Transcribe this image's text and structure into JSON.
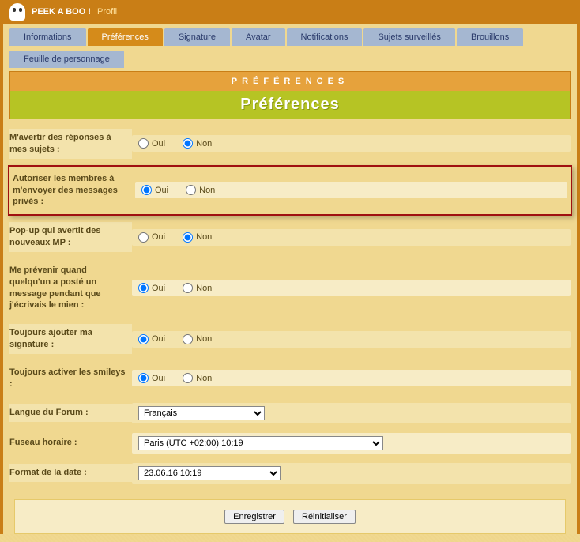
{
  "header": {
    "site_title": "PEEK A BOO !",
    "section": "Profil"
  },
  "tabs": {
    "informations": "Informations",
    "preferences": "Préférences",
    "signature": "Signature",
    "avatar": "Avatar",
    "notifications": "Notifications",
    "sujets": "Sujets surveillés",
    "brouillons": "Brouillons",
    "feuille": "Feuille de personnage"
  },
  "banner": {
    "crumb": "PRÉFÉRENCES",
    "stylized": "Préférences"
  },
  "labels": {
    "oui": "Oui",
    "non": "Non"
  },
  "rows": {
    "notify_responses": {
      "label": "M'avertir des réponses à mes sujets :",
      "value": "Non"
    },
    "allow_pm": {
      "label": "Autoriser les membres à m'envoyer des messages privés :",
      "value": "Oui"
    },
    "popup_pm": {
      "label": "Pop-up qui avertit des nouveaux MP :",
      "value": "Non"
    },
    "notify_concurrent": {
      "label": "Me prévenir quand quelqu'un a posté un message pendant que j'écrivais le mien :",
      "value": "Oui"
    },
    "add_signature": {
      "label": "Toujours ajouter ma signature :",
      "value": "Oui"
    },
    "enable_smileys": {
      "label": "Toujours activer les smileys :",
      "value": "Oui"
    },
    "language": {
      "label": "Langue du Forum :",
      "value": "Français"
    },
    "timezone": {
      "label": "Fuseau horaire :",
      "value": "Paris (UTC +02:00) 10:19"
    },
    "date_format": {
      "label": "Format de la date :",
      "value": "23.06.16 10:19"
    }
  },
  "buttons": {
    "save": "Enregistrer",
    "reset": "Réinitialiser"
  }
}
